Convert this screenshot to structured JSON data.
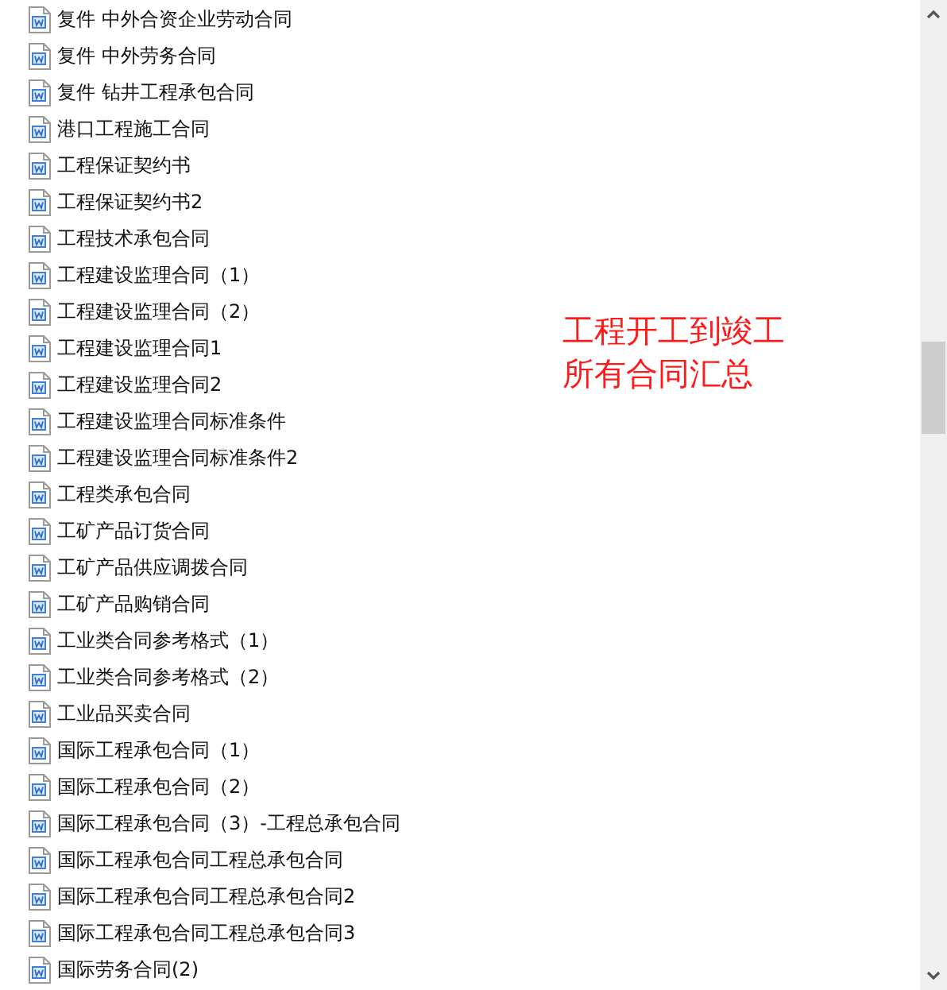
{
  "files": [
    {
      "name": "复件 中外合资企业劳动合同"
    },
    {
      "name": "复件 中外劳务合同"
    },
    {
      "name": "复件 钻井工程承包合同"
    },
    {
      "name": "港口工程施工合同"
    },
    {
      "name": "工程保证契约书"
    },
    {
      "name": "工程保证契约书2"
    },
    {
      "name": "工程技术承包合同"
    },
    {
      "name": "工程建设监理合同（1）"
    },
    {
      "name": "工程建设监理合同（2）"
    },
    {
      "name": "工程建设监理合同1"
    },
    {
      "name": "工程建设监理合同2"
    },
    {
      "name": "工程建设监理合同标准条件"
    },
    {
      "name": "工程建设监理合同标准条件2"
    },
    {
      "name": "工程类承包合同"
    },
    {
      "name": "工矿产品订货合同"
    },
    {
      "name": "工矿产品供应调拨合同"
    },
    {
      "name": "工矿产品购销合同"
    },
    {
      "name": "工业类合同参考格式（1）"
    },
    {
      "name": "工业类合同参考格式（2）"
    },
    {
      "name": "工业品买卖合同"
    },
    {
      "name": "国际工程承包合同（1）"
    },
    {
      "name": "国际工程承包合同（2）"
    },
    {
      "name": "国际工程承包合同（3）-工程总承包合同"
    },
    {
      "name": "国际工程承包合同工程总承包合同"
    },
    {
      "name": "国际工程承包合同工程总承包合同2"
    },
    {
      "name": "国际工程承包合同工程总承包合同3"
    },
    {
      "name": "国际劳务合同(2)"
    }
  ],
  "note": [
    "工程开工到竣工",
    "所有合同汇总"
  ]
}
